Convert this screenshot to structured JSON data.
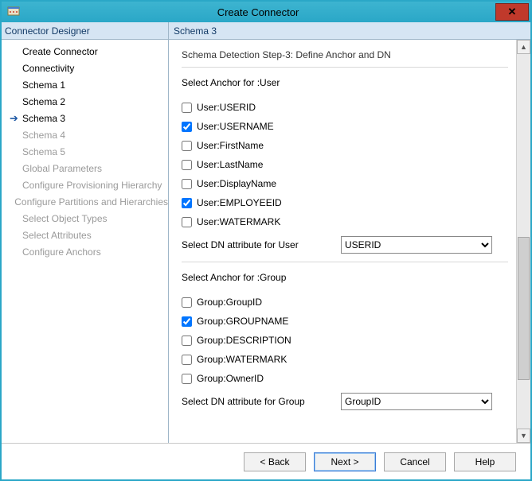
{
  "window": {
    "title": "Create Connector",
    "close_glyph": "✕"
  },
  "header": {
    "left": "Connector Designer",
    "right": "Schema 3"
  },
  "nav": {
    "items": [
      {
        "label": "Create Connector",
        "dim": false,
        "current": false
      },
      {
        "label": "Connectivity",
        "dim": false,
        "current": false
      },
      {
        "label": "Schema 1",
        "dim": false,
        "current": false
      },
      {
        "label": "Schema 2",
        "dim": false,
        "current": false
      },
      {
        "label": "Schema 3",
        "dim": false,
        "current": true
      },
      {
        "label": "Schema 4",
        "dim": true,
        "current": false
      },
      {
        "label": "Schema 5",
        "dim": true,
        "current": false
      },
      {
        "label": "Global Parameters",
        "dim": true,
        "current": false
      },
      {
        "label": "Configure Provisioning Hierarchy",
        "dim": true,
        "current": false
      },
      {
        "label": "Configure Partitions and Hierarchies",
        "dim": true,
        "current": false
      },
      {
        "label": "Select Object Types",
        "dim": true,
        "current": false
      },
      {
        "label": "Select Attributes",
        "dim": true,
        "current": false
      },
      {
        "label": "Configure Anchors",
        "dim": true,
        "current": false
      }
    ]
  },
  "schema": {
    "step_title": "Schema Detection Step-3: Define Anchor and DN",
    "user": {
      "heading": "Select Anchor for :User",
      "checks": [
        {
          "label": "User:USERID",
          "checked": false
        },
        {
          "label": "User:USERNAME",
          "checked": true
        },
        {
          "label": "User:FirstName",
          "checked": false
        },
        {
          "label": "User:LastName",
          "checked": false
        },
        {
          "label": "User:DisplayName",
          "checked": false
        },
        {
          "label": "User:EMPLOYEEID",
          "checked": true
        },
        {
          "label": "User:WATERMARK",
          "checked": false
        }
      ],
      "dn_label": "Select DN attribute for User",
      "dn_value": "USERID"
    },
    "group": {
      "heading": "Select Anchor for :Group",
      "checks": [
        {
          "label": "Group:GroupID",
          "checked": false
        },
        {
          "label": "Group:GROUPNAME",
          "checked": true
        },
        {
          "label": "Group:DESCRIPTION",
          "checked": false
        },
        {
          "label": "Group:WATERMARK",
          "checked": false
        },
        {
          "label": "Group:OwnerID",
          "checked": false
        }
      ],
      "dn_label": "Select DN attribute for Group",
      "dn_value": "GroupID"
    }
  },
  "buttons": {
    "back": "<  Back",
    "next": "Next  >",
    "cancel": "Cancel",
    "help": "Help"
  }
}
